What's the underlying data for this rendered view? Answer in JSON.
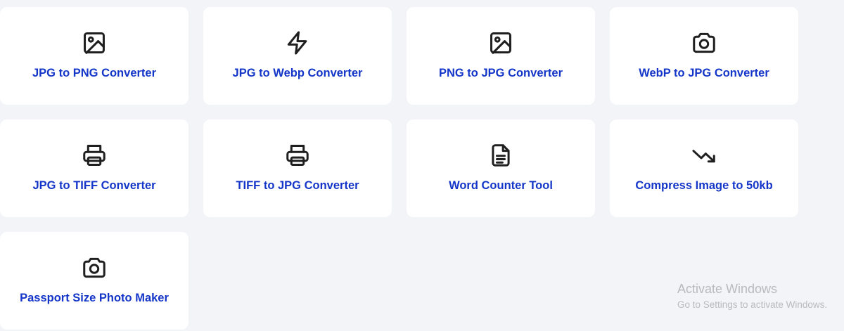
{
  "tools": [
    {
      "label": "JPG to PNG Converter",
      "icon": "image-icon"
    },
    {
      "label": "JPG to Webp Converter",
      "icon": "lightning-icon"
    },
    {
      "label": "PNG to JPG Converter",
      "icon": "image-icon"
    },
    {
      "label": "WebP to JPG Converter",
      "icon": "camera-icon"
    },
    {
      "label": "JPG to TIFF Converter",
      "icon": "printer-icon"
    },
    {
      "label": "TIFF to JPG Converter",
      "icon": "printer-icon"
    },
    {
      "label": "Word Counter Tool",
      "icon": "document-icon"
    },
    {
      "label": "Compress Image to 50kb",
      "icon": "trending-down-icon"
    },
    {
      "label": "Passport Size Photo Maker",
      "icon": "camera-icon"
    }
  ],
  "watermark": {
    "title": "Activate Windows",
    "subtitle": "Go to Settings to activate Windows."
  },
  "colors": {
    "background": "#f3f4f8",
    "card": "#ffffff",
    "label": "#1436c8",
    "icon": "#1f1f1f"
  }
}
